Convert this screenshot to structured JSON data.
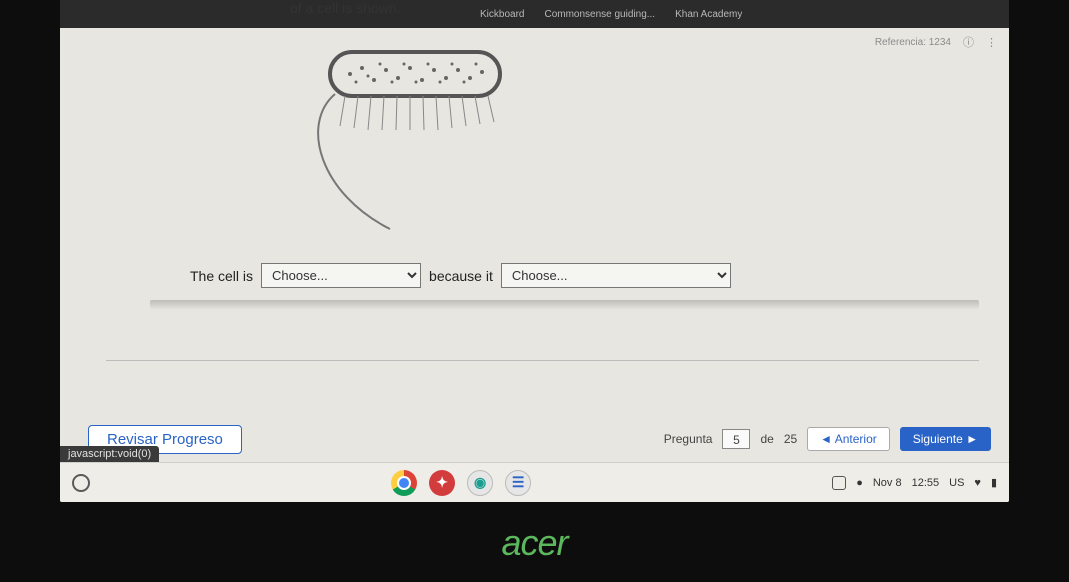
{
  "browser": {
    "tabs": [
      "Kickboard",
      "Commonsense guiding...",
      "Khan Academy"
    ]
  },
  "header": {
    "question_id": "Referencia: 1234"
  },
  "question": {
    "prompt": "of a cell is shown.",
    "sentence_part1": "The cell is",
    "sentence_part2": "because it",
    "choose_placeholder": "Choose..."
  },
  "footer": {
    "review_label": "Revisar Progreso",
    "question_word": "Pregunta",
    "of_word": "de",
    "current": "5",
    "total": "25",
    "prev_label": "◄ Anterior",
    "next_label": "Siguiente ►",
    "status_link": "javascript:void(0)"
  },
  "shelf": {
    "date": "Nov 8",
    "time": "12:55",
    "lang": "US"
  },
  "brand": "acer"
}
